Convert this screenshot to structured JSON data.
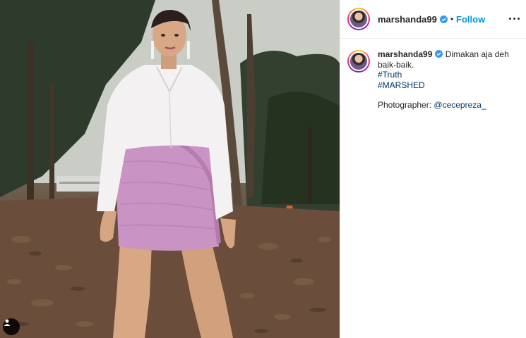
{
  "header": {
    "username": "marshanda99",
    "separator": "•",
    "follow_label": "Follow"
  },
  "caption": {
    "username": "marshanda99",
    "line1": "Dimakan aja deh",
    "line2": "baik-baik.",
    "hashtags": [
      "#Truth",
      "#MARSHED"
    ],
    "photographer_label": "Photographer:",
    "photographer_handle": "@cecepreza_"
  },
  "icons": {
    "verified": "verified-badge-icon",
    "more": "more-options-icon",
    "user_tag": "user-tag-icon"
  },
  "colors": {
    "follow": "#0095f6",
    "link": "#00376b",
    "verified": "#3897f0",
    "skirt": "#c993c4",
    "shirt": "#f4f1f2"
  }
}
